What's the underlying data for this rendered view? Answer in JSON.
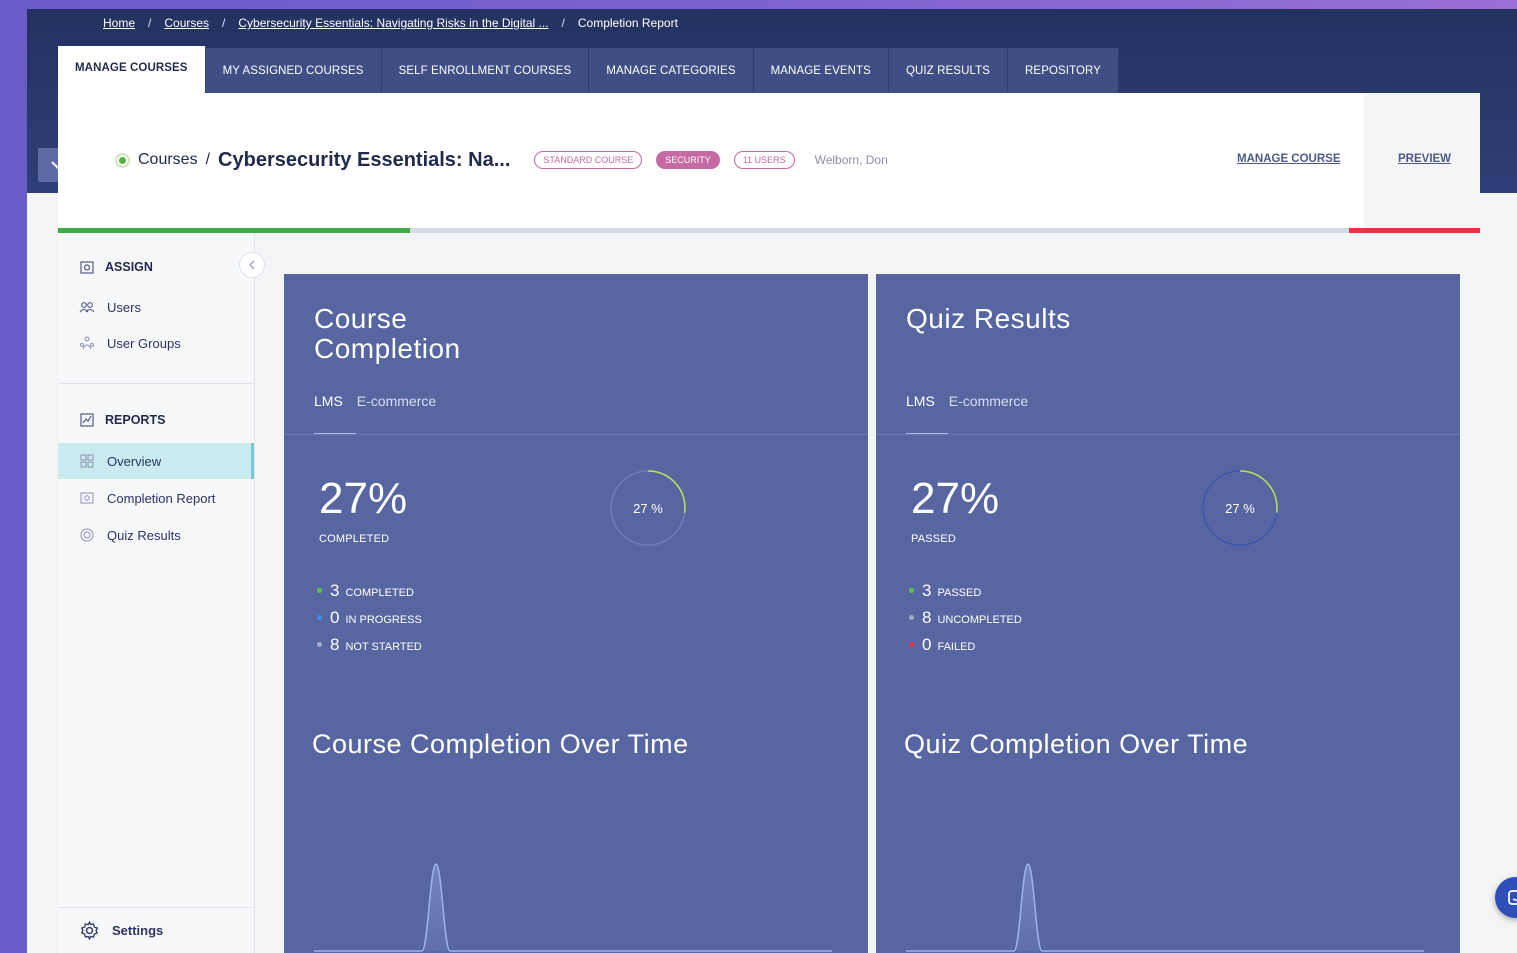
{
  "breadcrumb": {
    "home": "Home",
    "courses": "Courses",
    "course": "Cybersecurity Essentials: Navigating Risks in the Digital ...",
    "current": "Completion Report"
  },
  "tabs": [
    {
      "label": "MANAGE COURSES"
    },
    {
      "label": "MY ASSIGNED COURSES"
    },
    {
      "label": "SELF ENROLLMENT COURSES"
    },
    {
      "label": "MANAGE CATEGORIES"
    },
    {
      "label": "MANAGE EVENTS"
    },
    {
      "label": "QUIZ RESULTS"
    },
    {
      "label": "REPOSITORY"
    }
  ],
  "course": {
    "crumb": "Courses",
    "sep": "/",
    "title": "Cybersecurity Essentials: Na...",
    "pill_type": "STANDARD COURSE",
    "pill_category": "SECURITY",
    "pill_users": "11 USERS",
    "owner": "Welborn, Don",
    "manage": "MANAGE COURSE",
    "preview": "PREVIEW"
  },
  "sidebar": {
    "assign_title": "ASSIGN",
    "users": "Users",
    "user_groups": "User Groups",
    "reports_title": "REPORTS",
    "overview": "Overview",
    "completion_report": "Completion Report",
    "quiz_results": "Quiz Results",
    "settings": "Settings"
  },
  "course_panel": {
    "title": "Course Completion",
    "tab_lms": "LMS",
    "tab_ecom": "E-commerce",
    "big": "27%",
    "big_label": "COMPLETED",
    "ring_label": "27 %",
    "ring_fraction": 0.27,
    "legend": [
      {
        "num": "3",
        "label": "COMPLETED",
        "color": "#5cc24a"
      },
      {
        "num": "0",
        "label": "IN PROGRESS",
        "color": "#3b8de8"
      },
      {
        "num": "8",
        "label": "NOT STARTED",
        "color": "#a3aac8"
      }
    ],
    "chart_title": "Course Completion Over Time"
  },
  "quiz_panel": {
    "title": "Quiz Results",
    "tab_lms": "LMS",
    "tab_ecom": "E-commerce",
    "big": "27%",
    "big_label": "PASSED",
    "ring_label": "27 %",
    "ring_fraction": 0.27,
    "legend": [
      {
        "num": "3",
        "label": "PASSED",
        "color": "#5cc24a"
      },
      {
        "num": "8",
        "label": "UNCOMPLETED",
        "color": "#a3aac8"
      },
      {
        "num": "0",
        "label": "FAILED",
        "color": "#e53447"
      }
    ],
    "chart_title": "Quiz Completion Over Time"
  },
  "colors": {
    "accent_green": "#3dab4a",
    "accent_red": "#e53447",
    "panel_bg": "#5766a0"
  }
}
